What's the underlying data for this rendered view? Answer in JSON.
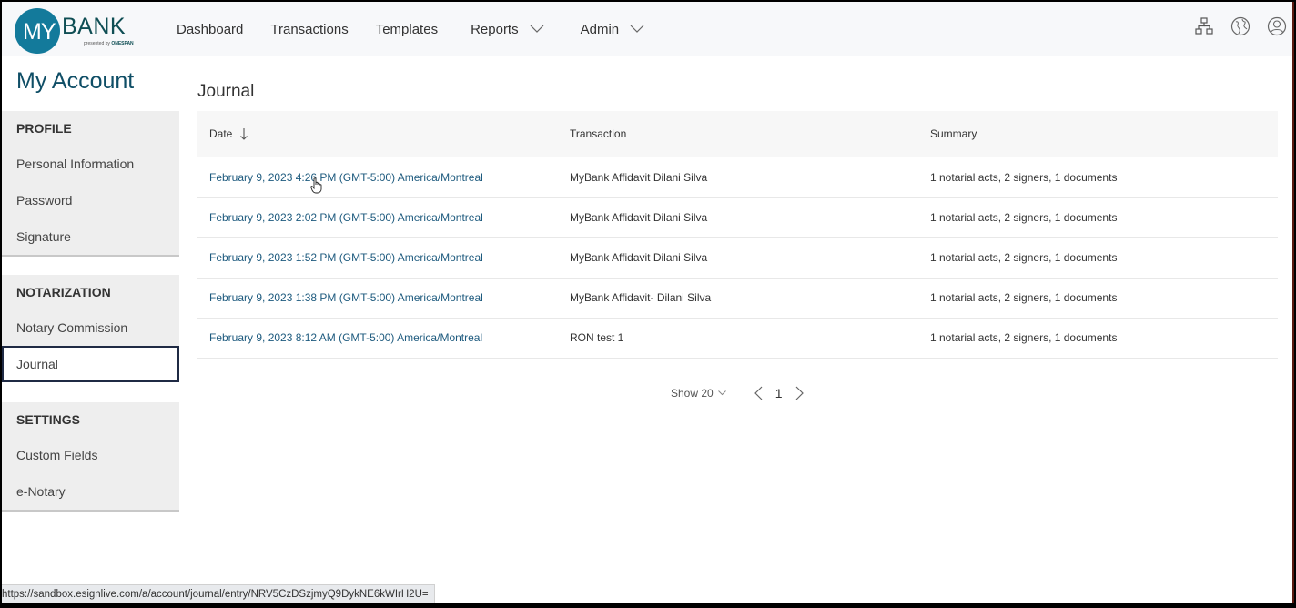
{
  "brand": {
    "logo_my": "MY",
    "logo_bank": "BANK",
    "logo_sub_prefix": "presented by",
    "logo_sub_brand": "ONESPAN",
    "accent": "#137a9b"
  },
  "nav": {
    "items": [
      {
        "label": "Dashboard",
        "dropdown": false
      },
      {
        "label": "Transactions",
        "dropdown": false
      },
      {
        "label": "Templates",
        "dropdown": false
      },
      {
        "label": "Reports",
        "dropdown": true
      },
      {
        "label": "Admin",
        "dropdown": true
      }
    ],
    "icons": [
      "sitemap-icon",
      "globe-icon",
      "user-icon"
    ]
  },
  "sidebar": {
    "title": "My Account",
    "groups": [
      {
        "heading": "PROFILE",
        "items": [
          "Personal Information",
          "Password",
          "Signature"
        ]
      },
      {
        "heading": "NOTARIZATION",
        "items": [
          "Notary Commission",
          "Journal"
        ]
      },
      {
        "heading": "SETTINGS",
        "items": [
          "Custom Fields",
          "e-Notary"
        ]
      }
    ],
    "active_item": "Journal"
  },
  "main": {
    "title": "Journal",
    "columns": [
      "Date",
      "Transaction",
      "Summary"
    ],
    "sort_indicator": "descending",
    "rows": [
      {
        "date": "February 9, 2023 4:26 PM (GMT-5:00) America/Montreal",
        "transaction": "MyBank Affidavit Dilani Silva",
        "summary": "1 notarial acts, 2 signers, 1 documents"
      },
      {
        "date": "February 9, 2023 2:02 PM (GMT-5:00) America/Montreal",
        "transaction": "MyBank Affidavit Dilani Silva",
        "summary": "1 notarial acts, 2 signers, 1 documents"
      },
      {
        "date": "February 9, 2023 1:52 PM (GMT-5:00) America/Montreal",
        "transaction": "MyBank Affidavit Dilani Silva",
        "summary": "1 notarial acts, 2 signers, 1 documents"
      },
      {
        "date": "February 9, 2023 1:38 PM (GMT-5:00) America/Montreal",
        "transaction": "MyBank Affidavit- Dilani Silva",
        "summary": "1 notarial acts, 2 signers, 1 documents"
      },
      {
        "date": "February 9, 2023 8:12 AM (GMT-5:00) America/Montreal",
        "transaction": "RON test 1",
        "summary": "1 notarial acts, 2 signers, 1 documents"
      }
    ],
    "pager": {
      "show_label": "Show 20",
      "current_page": "1"
    }
  },
  "statusbar": {
    "url": "https://sandbox.esignlive.com/a/account/journal/entry/NRV5CzDSzjmyQ9DykNE6kWIrH2U="
  }
}
